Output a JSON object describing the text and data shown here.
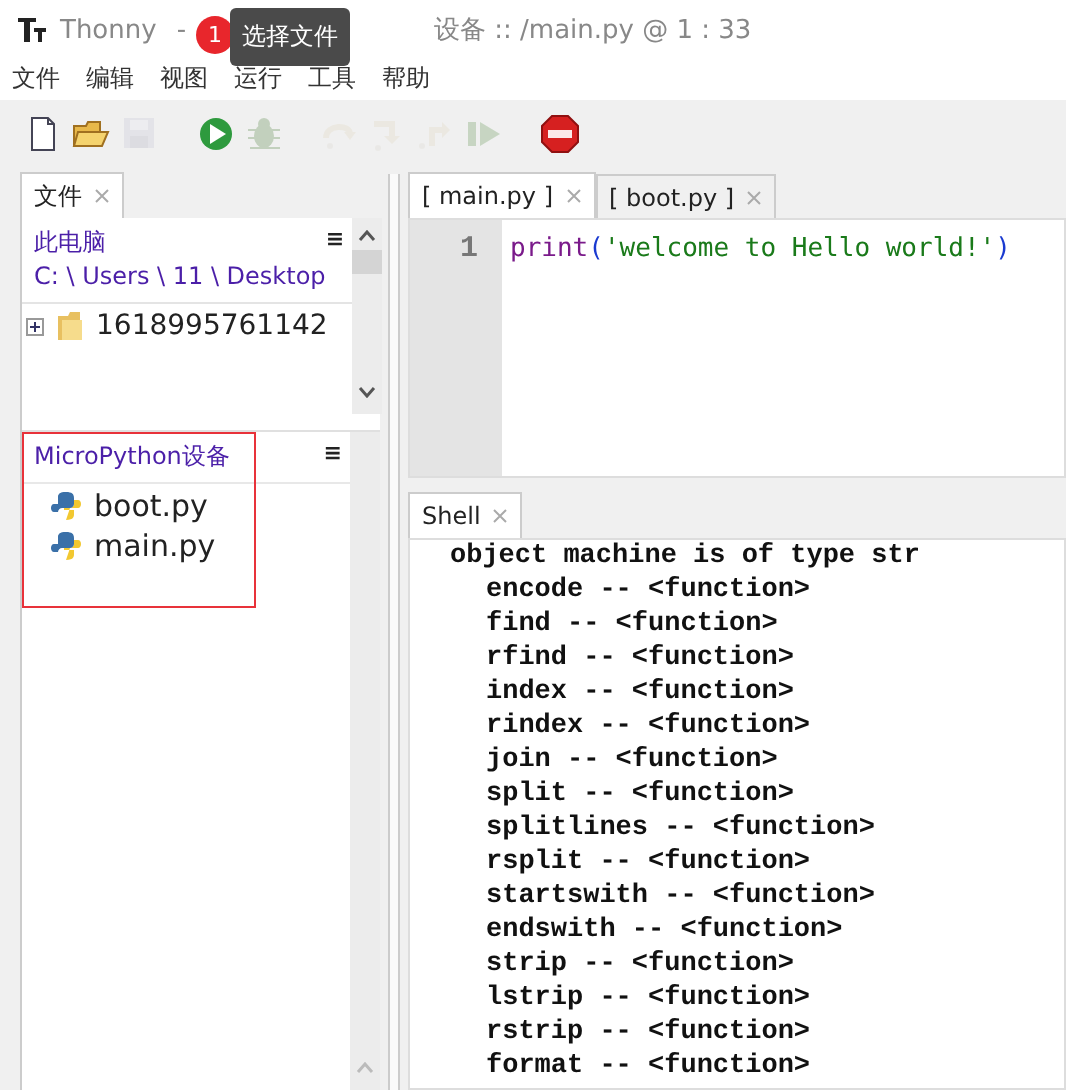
{
  "window": {
    "app": "Thonny",
    "separator": "-",
    "title_rest": "设备 :: /main.py  @  1 : 33"
  },
  "annotation": {
    "badge": "1",
    "tooltip": "选择文件"
  },
  "menu": [
    "文件",
    "编辑",
    "视图",
    "运行",
    "工具",
    "帮助"
  ],
  "toolbar": [
    {
      "kind": "new",
      "disabled": false
    },
    {
      "kind": "open",
      "disabled": false
    },
    {
      "kind": "save",
      "disabled": true
    },
    {
      "kind": "run",
      "disabled": false
    },
    {
      "kind": "debug",
      "disabled": true
    },
    {
      "kind": "step_over",
      "disabled": true
    },
    {
      "kind": "step_into",
      "disabled": true
    },
    {
      "kind": "step_out",
      "disabled": true
    },
    {
      "kind": "resume",
      "disabled": true
    },
    {
      "kind": "stop",
      "disabled": false
    }
  ],
  "files_panel": {
    "tab": {
      "label": "文件",
      "selected": true
    },
    "computer": {
      "title": "此电脑",
      "path": "C: \\ Users \\ 11 \\ Desktop",
      "menu": "≡",
      "items": [
        {
          "name": "1618995761142",
          "expanded": false
        }
      ]
    },
    "device": {
      "title": "MicroPython设备",
      "menu": "≡",
      "highlighted": true,
      "files": [
        "boot.py",
        "main.py"
      ]
    }
  },
  "editor": {
    "tabs": [
      {
        "label": "[ main.py ]",
        "selected": true
      },
      {
        "label": "[ boot.py ]",
        "selected": false
      }
    ],
    "lines": [
      {
        "number": "1",
        "tokens": [
          {
            "kind": "builtin",
            "text": "print"
          },
          {
            "kind": "paren",
            "text": "("
          },
          {
            "kind": "string",
            "text": "'welcome to Hello world!'"
          },
          {
            "kind": "paren",
            "text": ")"
          }
        ]
      }
    ]
  },
  "shell": {
    "tab": {
      "label": "Shell",
      "selected": true
    },
    "output": [
      {
        "text": "object machine is of type str",
        "children": [
          {
            "text": "encode -- <function>"
          },
          {
            "text": "find -- <function>"
          },
          {
            "text": "rfind -- <function>"
          },
          {
            "text": "index -- <function>"
          },
          {
            "text": "rindex -- <function>"
          },
          {
            "text": "join -- <function>"
          },
          {
            "text": "split -- <function>"
          },
          {
            "text": "splitlines -- <function>"
          },
          {
            "text": "rsplit -- <function>"
          },
          {
            "text": "startswith -- <function>"
          },
          {
            "text": "endswith -- <function>"
          },
          {
            "text": "strip -- <function>"
          },
          {
            "text": "lstrip -- <function>"
          },
          {
            "text": "rstrip -- <function>"
          },
          {
            "text": "format -- <function>"
          }
        ]
      }
    ]
  }
}
